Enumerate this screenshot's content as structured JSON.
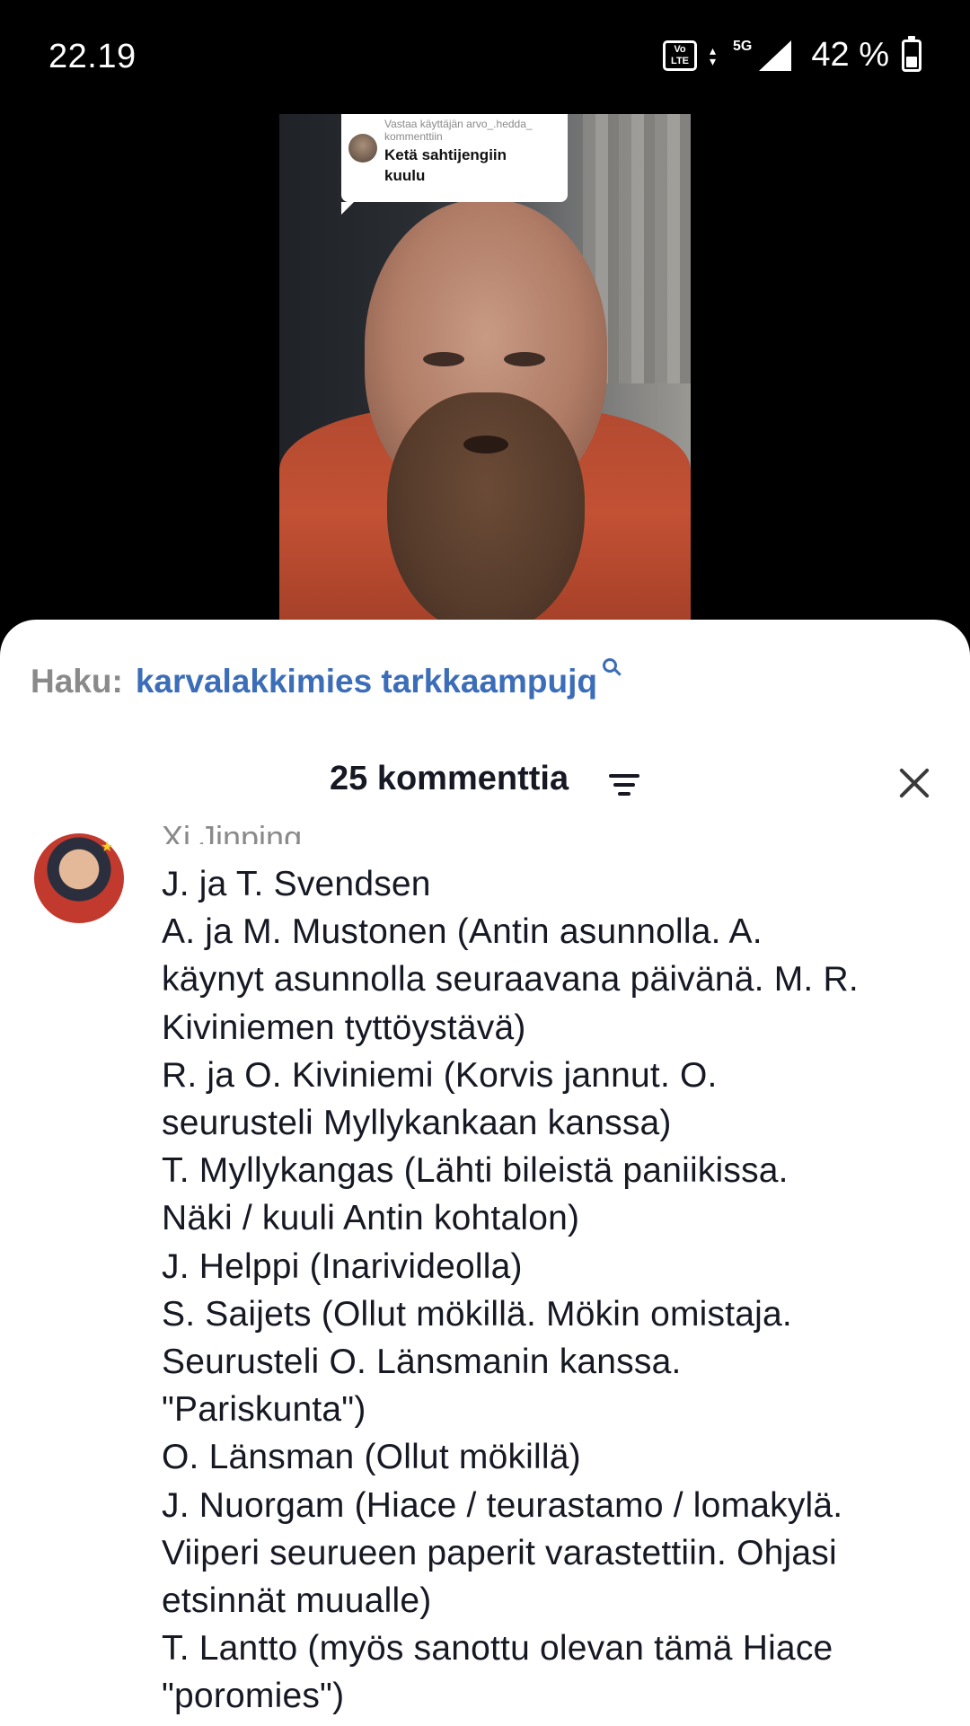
{
  "status_bar": {
    "time": "22.19",
    "volte": "Vo LTE",
    "network": "5G",
    "battery": "42 %",
    "battery_level": 0.42
  },
  "video": {
    "reply": {
      "meta_line1": "Vastaa käyttäjän arvo_.hedda_",
      "meta_line2": "kommenttiin",
      "text_line1": "Ketä sahtijengiin",
      "text_line2": "kuulu"
    }
  },
  "search": {
    "label": "Haku:",
    "query": "karvalakkimies tarkkaampujq"
  },
  "comments_header": {
    "count_label": "25 kommenttia"
  },
  "comment": {
    "author": "Xi Jinping",
    "lines": [
      "J. ja T. Svendsen",
      "A. ja M. Mustonen (Antin asunnolla. A.",
      "käynyt asunnolla seuraavana päivänä. M. R.",
      "Kiviniemen tyttöystävä)",
      "R. ja O. Kiviniemi (Korvis jannut. O.",
      "seurusteli Myllykankaan kanssa)",
      "T. Myllykangas (Lähti bileistä paniikissa.",
      "Näki / kuuli Antin kohtalon)",
      "J. Helppi (Inarivideolla)",
      "S. Saijets (Ollut mökillä. Mökin omistaja.",
      "Seurusteli O. Länsmanin kanssa.",
      "\"Pariskunta\")",
      "O. Länsman (Ollut mökillä)",
      "J. Nuorgam (Hiace / teurastamo / lomakylä.",
      "Viiperi seurueen paperit varastettiin. Ohjasi",
      "etsinnät muualle)",
      "T. Lantto (myös sanottu olevan tämä Hiace",
      "\"poromies\")"
    ]
  }
}
